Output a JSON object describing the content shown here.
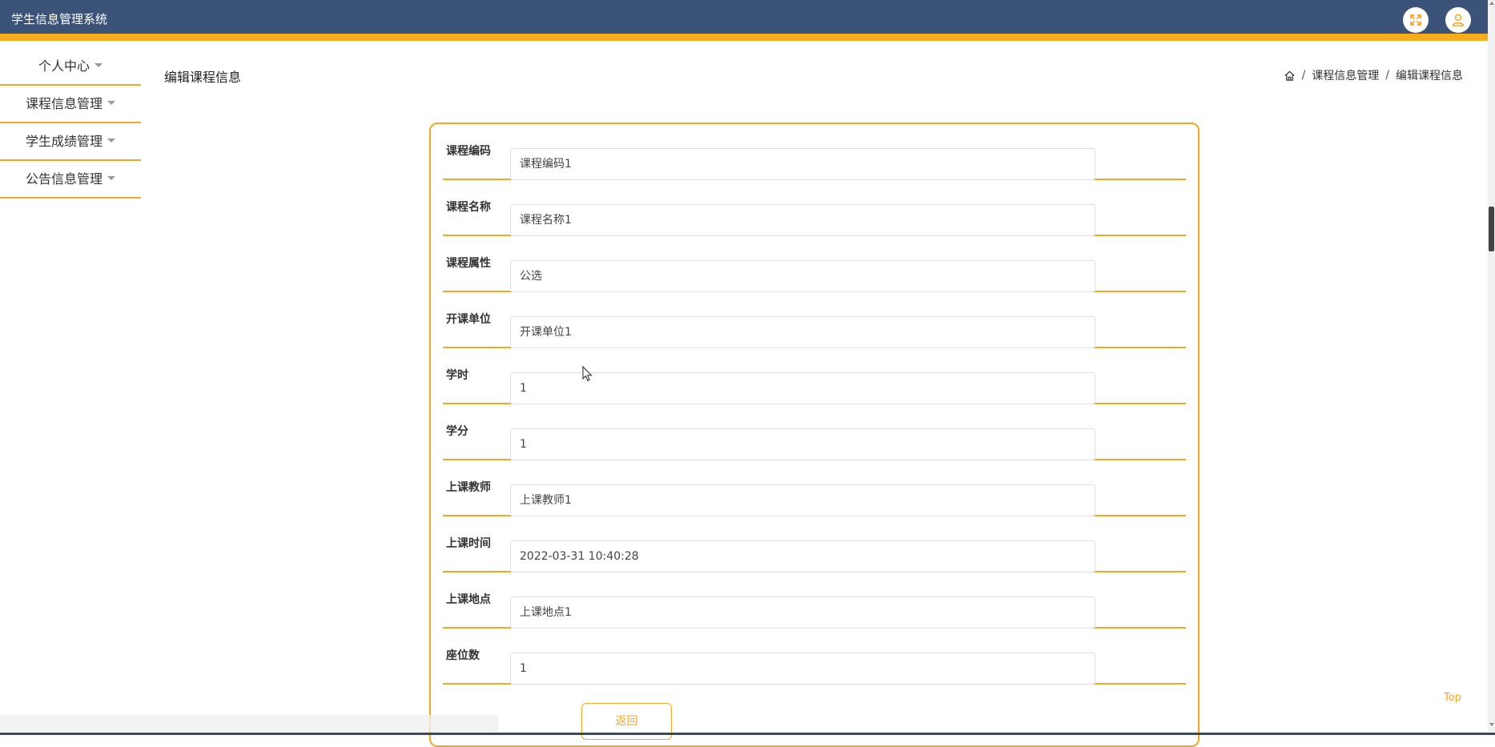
{
  "app": {
    "title": "学生信息管理系统"
  },
  "header_icons": {
    "fullscreen": "fullscreen-icon",
    "user": "user-icon"
  },
  "sidebar": {
    "items": [
      {
        "label": "个人中心"
      },
      {
        "label": "课程信息管理"
      },
      {
        "label": "学生成绩管理"
      },
      {
        "label": "公告信息管理"
      }
    ]
  },
  "page": {
    "title": "编辑课程信息"
  },
  "breadcrumb": {
    "home_icon": "home-icon",
    "items": [
      "课程信息管理",
      "编辑课程信息"
    ],
    "separator": "/"
  },
  "form": {
    "fields": [
      {
        "label": "课程编码",
        "value": "课程编码1"
      },
      {
        "label": "课程名称",
        "value": "课程名称1"
      },
      {
        "label": "课程属性",
        "value": "公选"
      },
      {
        "label": "开课单位",
        "value": "开课单位1"
      },
      {
        "label": "学时",
        "value": "1"
      },
      {
        "label": "学分",
        "value": "1"
      },
      {
        "label": "上课教师",
        "value": "上课教师1"
      },
      {
        "label": "上课时间",
        "value": "2022-03-31 10:40:28"
      },
      {
        "label": "上课地点",
        "value": "上课地点1"
      },
      {
        "label": "座位数",
        "value": "1"
      }
    ],
    "back_label": "返回"
  },
  "top_link": "Top",
  "colors": {
    "header": "#3b5378",
    "accent": "#f7ac1c",
    "border": "#f5a623"
  }
}
